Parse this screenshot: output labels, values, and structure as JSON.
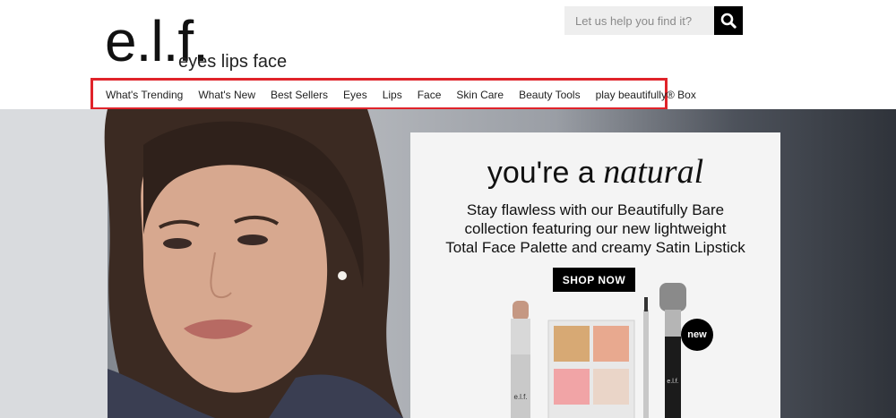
{
  "brand": {
    "logo_mark": "e.l.f.",
    "tagline": "eyes lips face"
  },
  "search": {
    "placeholder": "Let us help you find it?",
    "button_icon": "search-icon"
  },
  "nav": {
    "highlight_color": "#e0232a",
    "items": [
      {
        "label": "What's Trending"
      },
      {
        "label": "What's New"
      },
      {
        "label": "Best Sellers"
      },
      {
        "label": "Eyes"
      },
      {
        "label": "Lips"
      },
      {
        "label": "Face"
      },
      {
        "label": "Skin Care"
      },
      {
        "label": "Beauty Tools"
      },
      {
        "label": "play beautifully® Box"
      }
    ]
  },
  "hero": {
    "title_prefix": "you're a",
    "title_emphasis": "natural",
    "copy_lines": [
      "Stay flawless with our Beautifully Bare",
      "collection featuring our new lightweight",
      "Total Face Palette and creamy Satin Lipstick"
    ],
    "cta_label": "SHOP NOW",
    "badge_label": "new",
    "product_brand_mark": "e.l.f."
  }
}
